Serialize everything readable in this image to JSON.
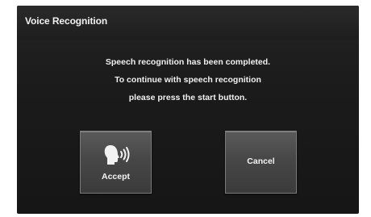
{
  "window": {
    "title": "Voice Recognition"
  },
  "dialog": {
    "message_lines": [
      "Speech recognition has been completed.",
      "To continue with speech recognition",
      "please press the start button."
    ]
  },
  "buttons": {
    "accept": {
      "label": "Accept",
      "icon": "speaking-head-icon"
    },
    "cancel": {
      "label": "Cancel"
    }
  },
  "colors": {
    "background": "#1c1c1c",
    "button": "#474747",
    "text": "#f0f0f0"
  }
}
